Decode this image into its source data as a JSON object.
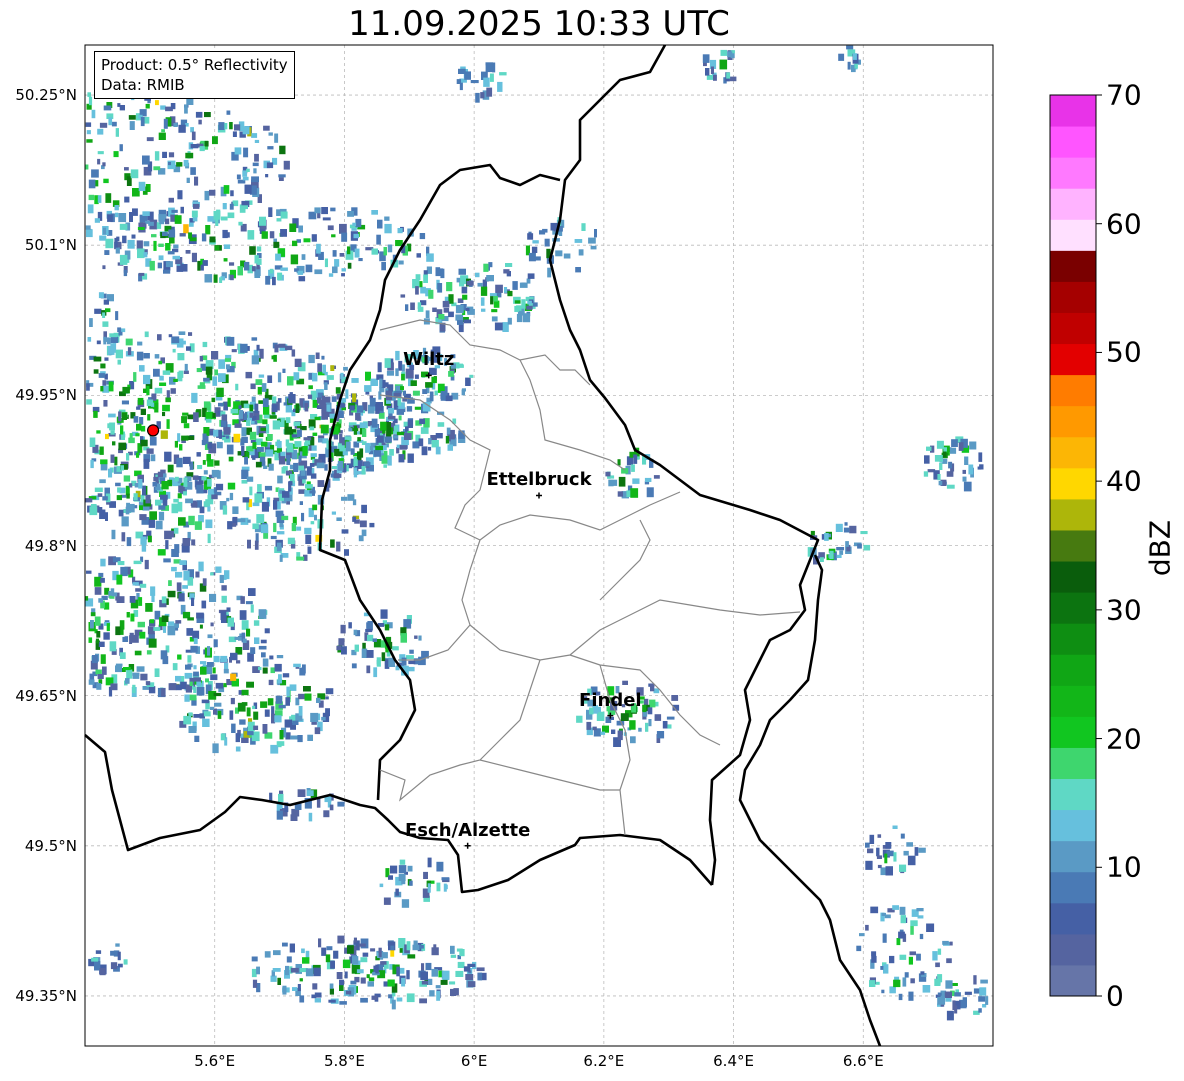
{
  "title": "11.09.2025 10:33 UTC",
  "info_box": {
    "product": "Product: 0.5° Reflectivity",
    "data_source": "Data: RMIB"
  },
  "lat_ticks": [
    "50.25°N",
    "50.1°N",
    "49.95°N",
    "49.8°N",
    "49.65°N",
    "49.5°N",
    "49.35°N"
  ],
  "lon_ticks": [
    "5.6°E",
    "5.8°E",
    "6°E",
    "6.2°E",
    "6.4°E",
    "6.6°E"
  ],
  "cities": [
    {
      "name": "Wiltz",
      "lon": 5.93,
      "lat": 49.97
    },
    {
      "name": "Ettelbruck",
      "lon": 6.1,
      "lat": 49.85
    },
    {
      "name": "Findel",
      "lon": 6.21,
      "lat": 49.63
    },
    {
      "name": "Esch/Alzette",
      "lon": 5.99,
      "lat": 49.5
    }
  ],
  "radar_site": {
    "lon": 5.505,
    "lat": 49.915,
    "color": "#ff0000"
  },
  "colorbar": {
    "label": "dBZ",
    "ticks": [
      "0",
      "10",
      "20",
      "30",
      "40",
      "50",
      "60",
      "70"
    ],
    "colors": [
      "#6675a8",
      "#5564a0",
      "#4560a5",
      "#4a7ab5",
      "#5a9ac5",
      "#66c0dd",
      "#5fd8c5",
      "#3ed66e",
      "#11c620",
      "#12b618",
      "#10a615",
      "#0e8e12",
      "#0c7410",
      "#0a5d0c",
      "#477a10",
      "#adb60a",
      "#ffd700",
      "#fcb605",
      "#ff9900",
      "#ff7c00",
      "#e30000",
      "#c00000",
      "#a50000",
      "#7a0000",
      "#ffe0ff",
      "#ffb3ff",
      "#ff79ff",
      "#ff55ff",
      "#e833e8"
    ]
  },
  "map_extent": {
    "lon_min": 5.4,
    "lon_max": 6.8,
    "lat_min": 49.3,
    "lat_max": 50.3
  }
}
